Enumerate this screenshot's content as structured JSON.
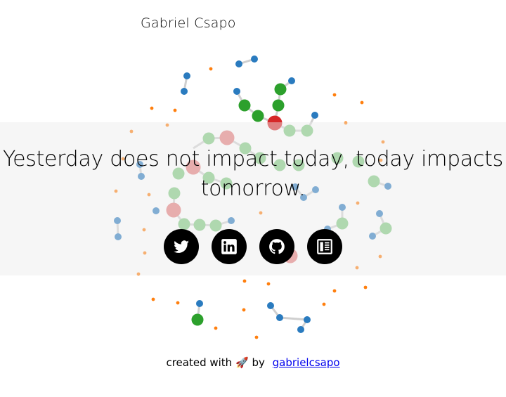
{
  "author": "Gabriel Csapo",
  "quote": {
    "line1": "Yesterday does not impact today, today impacts",
    "line2": "tomorrow."
  },
  "socials": [
    {
      "name": "twitter",
      "icon": "twitter-icon"
    },
    {
      "name": "linkedin",
      "icon": "linkedin-icon"
    },
    {
      "name": "github",
      "icon": "github-icon"
    },
    {
      "name": "resume",
      "icon": "document-icon"
    }
  ],
  "footer": {
    "created_with": "created with",
    "rocket": "🚀",
    "by": "by",
    "link_text": "gabrielcsapo"
  },
  "colors": {
    "blue": "#2a7bbf",
    "green": "#2ca02c",
    "red": "#d62728",
    "orange": "#ff7f0e",
    "link": "#0000ee"
  }
}
